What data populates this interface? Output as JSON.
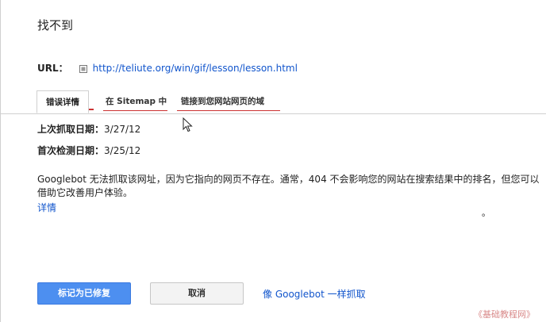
{
  "dialog": {
    "title": "找不到"
  },
  "url": {
    "label": "URL：",
    "link_text": "http://teliute.org/win/gif/lesson/lesson.html",
    "icon": "external-link-icon"
  },
  "tabs": [
    {
      "label": "错误详情",
      "active": true
    },
    {
      "label": "在 Sitemap 中",
      "active": false
    },
    {
      "label": "链接到您网站网页的域",
      "active": false
    }
  ],
  "accent_color": "#cc3333",
  "fields": {
    "last_crawled_label": "上次抓取日期：",
    "last_crawled_value": "3/27/12",
    "first_detected_label": "首次检测日期：",
    "first_detected_value": "3/25/12"
  },
  "description": "Googlebot 无法抓取该网址，因为它指向的网页不存在。通常，404 不会影响您的网站在搜索结果中的排名，但您可以借助它改善用户体验。",
  "details_link": "详情",
  "stray_mark": "。",
  "buttons": {
    "mark_fixed": "标记为已修复",
    "cancel": "取消",
    "fetch_as_googlebot": "像 Googlebot 一样抓取"
  },
  "watermark": "《基础教程网》"
}
